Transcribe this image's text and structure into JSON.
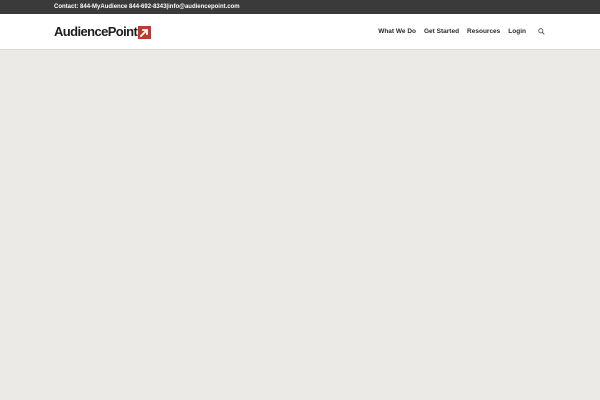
{
  "topbar": {
    "contact_label": "Contact:",
    "phone_vanity": "844-MyAudience",
    "phone_number": "844-692-8343",
    "separator": "|",
    "email": "info@audiencepoint.com"
  },
  "header": {
    "logo_text": "AudiencePoint",
    "logo_accent_color": "#c0392b",
    "nav": [
      {
        "label": "What We Do"
      },
      {
        "label": "Get Started"
      },
      {
        "label": "Resources"
      },
      {
        "label": "Login"
      }
    ],
    "search_icon": "search-icon"
  },
  "colors": {
    "topbar_bg": "#3a3a3a",
    "header_bg": "#ffffff",
    "page_bg": "#eceae6"
  }
}
